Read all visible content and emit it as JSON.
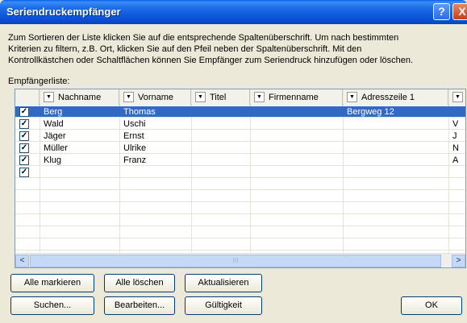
{
  "window": {
    "title": "Seriendruckempfänger",
    "help": "?",
    "close": "X"
  },
  "intro": [
    "Zum Sortieren der Liste klicken Sie auf die entsprechende Spaltenüberschrift. Um nach bestimmten",
    "Kriterien zu filtern, z.B. Ort, klicken Sie auf den Pfeil neben der Spaltenüberschrift. Mit den",
    "Kontrollkästchen oder Schaltflächen können Sie Empfänger zum Seriendruck hinzufügen oder löschen."
  ],
  "list_label": "Empfängerliste:",
  "columns": [
    "Nachname",
    "Vorname",
    "Titel",
    "Firmenname",
    "Adresszeile 1"
  ],
  "rows": [
    {
      "checked": "✓",
      "nachname": "Berg",
      "vorname": "Thomas",
      "titel": "",
      "firma": "",
      "adresse": "Bergweg 12",
      "next": ""
    },
    {
      "checked": "✓",
      "nachname": "Wald",
      "vorname": "Uschi",
      "titel": "",
      "firma": "",
      "adresse": "",
      "next": "V"
    },
    {
      "checked": "✓",
      "nachname": "Jäger",
      "vorname": "Ernst",
      "titel": "",
      "firma": "",
      "adresse": "",
      "next": "J"
    },
    {
      "checked": "✓",
      "nachname": "Müller",
      "vorname": "Ulrike",
      "titel": "",
      "firma": "",
      "adresse": "",
      "next": "N"
    },
    {
      "checked": "✓",
      "nachname": "Klug",
      "vorname": "Franz",
      "titel": "",
      "firma": "",
      "adresse": "",
      "next": "A"
    },
    {
      "checked": "✓",
      "nachname": "",
      "vorname": "",
      "titel": "",
      "firma": "",
      "adresse": "",
      "next": ""
    }
  ],
  "scroll": {
    "left": "<",
    "right": ">",
    "grip": "III"
  },
  "buttons": {
    "mark_all": "Alle markieren",
    "delete_all": "Alle löschen",
    "refresh": "Aktualisieren",
    "search": "Suchen...",
    "edit": "Bearbeiten...",
    "validity": "Gültigkeit",
    "ok": "OK"
  },
  "colors": {
    "titlebar": "#0a57d8",
    "selection": "#316ac5",
    "dialog": "#ece9d8"
  }
}
